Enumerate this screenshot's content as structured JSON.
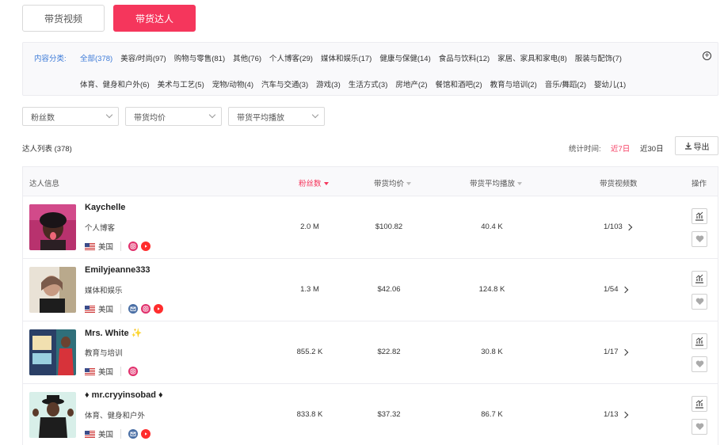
{
  "tabs": {
    "video": "带货视频",
    "creator": "带货达人"
  },
  "category_filter": {
    "label": "内容分类:",
    "row1": [
      "全部(378)",
      "美容/时尚(97)",
      "购物与零售(81)",
      "其他(76)",
      "个人博客(29)",
      "媒体和娱乐(17)",
      "健康与保健(14)",
      "食品与饮料(12)",
      "家居、家具和家电(8)",
      "服装与配饰(7)"
    ],
    "row2": [
      "体育、健身和户外(6)",
      "美术与工艺(5)",
      "宠物/动物(4)",
      "汽车与交通(3)",
      "游戏(3)",
      "生活方式(3)",
      "房地产(2)",
      "餐馆和酒吧(2)",
      "教育与培训(2)",
      "音乐/舞蹈(2)",
      "婴幼儿(1)"
    ],
    "active_index": 0
  },
  "filters": {
    "followers": "粉丝数",
    "avg_price": "带货均价",
    "avg_views": "带货平均播放"
  },
  "list_header": {
    "count_label": "达人列表 (378)",
    "stat_label": "统计时间:",
    "period_7": "近7日",
    "period_30": "近30日",
    "export_label": "导出"
  },
  "table": {
    "headers": {
      "info": "达人信息",
      "followers": "粉丝数",
      "avg_price": "带货均价",
      "avg_views": "带货平均播放",
      "video_count": "带货视频数",
      "actions": "操作"
    },
    "rows": [
      {
        "name": "Kaychelle",
        "category": "个人博客",
        "country": "美国",
        "followers": "2.0 M",
        "avg_price": "$100.82",
        "avg_views": "40.4 K",
        "videos": "1/103",
        "socials": [
          "instagram-icon",
          "youtube-icon"
        ]
      },
      {
        "name": "Emilyjeanne333",
        "category": "媒体和娱乐",
        "country": "美国",
        "followers": "1.3 M",
        "avg_price": "$42.06",
        "avg_views": "124.8 K",
        "videos": "1/54",
        "socials": [
          "email-icon",
          "instagram-icon",
          "youtube-icon"
        ]
      },
      {
        "name": "Mrs. White ✨",
        "category": "教育与培训",
        "country": "美国",
        "followers": "855.2 K",
        "avg_price": "$22.82",
        "avg_views": "30.8 K",
        "videos": "1/17",
        "socials": [
          "instagram-icon"
        ]
      },
      {
        "name": "♦ mr.cryyinsobad ♦",
        "category": "体育、健身和户外",
        "country": "美国",
        "followers": "833.8 K",
        "avg_price": "$37.32",
        "avg_views": "86.7 K",
        "videos": "1/13",
        "socials": [
          "email-icon",
          "youtube-icon"
        ]
      }
    ]
  },
  "colors": {
    "accent": "#f5365c",
    "link_blue": "#3d7bd8",
    "instagram": "#e1306c",
    "youtube": "#ff2d2d",
    "email": "#4a6fa5"
  }
}
